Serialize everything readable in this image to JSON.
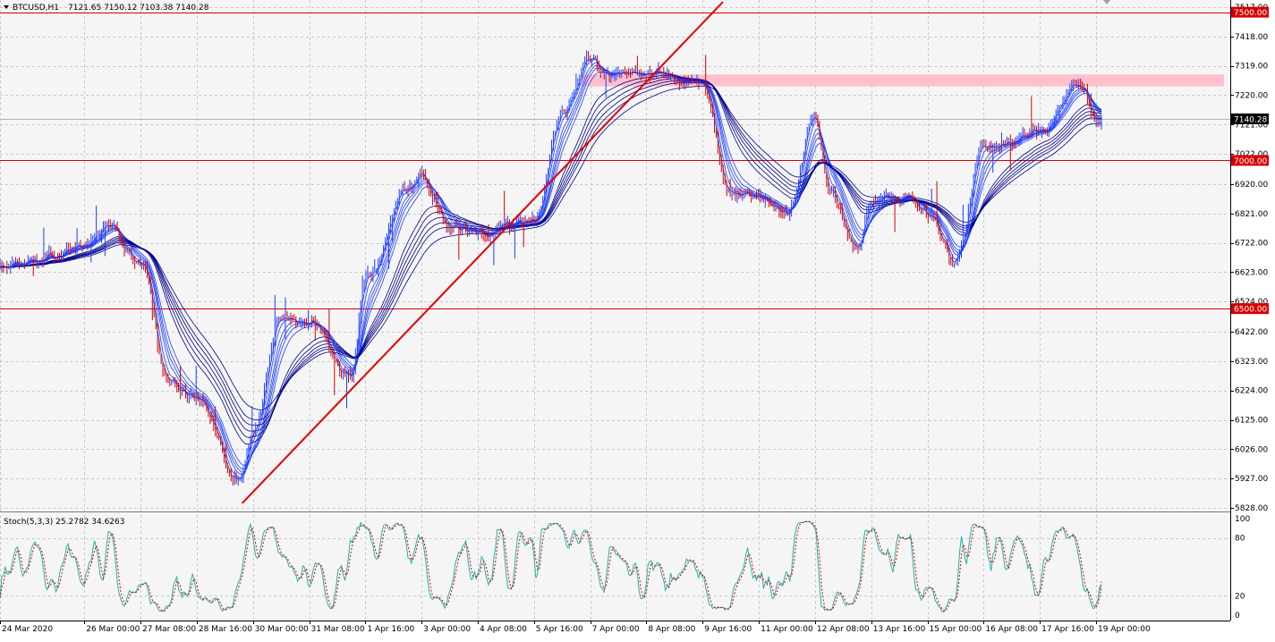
{
  "header": {
    "symbol_label": "BTCUSD,H1",
    "ohlc_label": "7121.65 7150.12 7103.38 7140.28"
  },
  "indicator": {
    "label": "Stoch(5,3,3) 25.2782 34.6263",
    "levels": [
      "100",
      "80",
      "20",
      "0"
    ]
  },
  "colors": {
    "background": "#f5f5f5",
    "grid": "#c8c8c8",
    "candle_up": "#1e3fff",
    "candle_down": "#d40000",
    "ma": "#00008b",
    "level_line": "#d40000",
    "trendline": "#e00000",
    "resistance_zone": "#ffc0cb",
    "stoch_main": "#20b2aa",
    "stoch_signal": "#d40000",
    "price_tag_bg": "#d40000",
    "price_tag_text": "#ffffff",
    "current_tag_bg": "#000000"
  },
  "price_axis": {
    "ticks": [
      "7517.00",
      "7418.00",
      "7319.00",
      "7220.00",
      "7121.00",
      "7022.00",
      "6920.00",
      "6821.00",
      "6722.00",
      "6623.00",
      "6524.00",
      "6422.00",
      "6323.00",
      "6224.00",
      "6125.00",
      "6026.00",
      "5927.00",
      "5828.00"
    ],
    "level_tags": [
      "7500.00",
      "7000.00",
      "6500.00"
    ],
    "current_price_tag": "7140.28"
  },
  "time_axis": {
    "labels": [
      "24 Mar 2020",
      "26 Mar 00:00",
      "27 Mar 08:00",
      "28 Mar 16:00",
      "30 Mar 00:00",
      "31 Mar 08:00",
      "1 Apr 16:00",
      "3 Apr 00:00",
      "4 Apr 08:00",
      "5 Apr 16:00",
      "7 Apr 00:00",
      "8 Apr 08:00",
      "9 Apr 16:00",
      "11 Apr 00:00",
      "12 Apr 08:00",
      "13 Apr 16:00",
      "15 Apr 00:00",
      "16 Apr 08:00",
      "17 Apr 16:00",
      "19 Apr 00:00"
    ]
  },
  "chart_data": {
    "type": "candlestick",
    "symbol": "BTCUSD",
    "timeframe": "H1",
    "last_ohlc": {
      "open": 7121.65,
      "high": 7150.12,
      "low": 7103.38,
      "close": 7140.28
    },
    "y_range": [
      5828,
      7517
    ],
    "horizontal_levels": [
      7500,
      7000,
      6500
    ],
    "resistance_zone": [
      7250,
      7290
    ],
    "trendline": [
      {
        "time": "30 Mar 00:00",
        "price": 5880
      },
      {
        "time": "10 Apr 00:00",
        "price": 7450
      }
    ],
    "price_path": [
      {
        "time": "24 Mar 2020",
        "price": 6650
      },
      {
        "time": "26 Mar 00:00",
        "price": 6700
      },
      {
        "time": "26 Mar 12:00",
        "price": 6780
      },
      {
        "time": "27 Mar 08:00",
        "price": 6660
      },
      {
        "time": "28 Mar 00:00",
        "price": 6250
      },
      {
        "time": "28 Mar 16:00",
        "price": 6190
      },
      {
        "time": "29 Mar 16:00",
        "price": 5930
      },
      {
        "time": "30 Mar 00:00",
        "price": 6080
      },
      {
        "time": "30 Mar 16:00",
        "price": 6480
      },
      {
        "time": "31 Mar 08:00",
        "price": 6460
      },
      {
        "time": "1 Apr 08:00",
        "price": 6260
      },
      {
        "time": "1 Apr 16:00",
        "price": 6600
      },
      {
        "time": "2 Apr 16:00",
        "price": 6900
      },
      {
        "time": "3 Apr 00:00",
        "price": 6950
      },
      {
        "time": "3 Apr 16:00",
        "price": 6780
      },
      {
        "time": "4 Apr 08:00",
        "price": 6760
      },
      {
        "time": "5 Apr 16:00",
        "price": 6800
      },
      {
        "time": "6 Apr 08:00",
        "price": 7150
      },
      {
        "time": "7 Apr 00:00",
        "price": 7340
      },
      {
        "time": "7 Apr 12:00",
        "price": 7280
      },
      {
        "time": "8 Apr 08:00",
        "price": 7300
      },
      {
        "time": "9 Apr 16:00",
        "price": 7270
      },
      {
        "time": "10 Apr 08:00",
        "price": 6880
      },
      {
        "time": "11 Apr 00:00",
        "price": 6880
      },
      {
        "time": "11 Apr 16:00",
        "price": 6820
      },
      {
        "time": "12 Apr 08:00",
        "price": 7150
      },
      {
        "time": "12 Apr 16:00",
        "price": 6900
      },
      {
        "time": "13 Apr 08:00",
        "price": 6700
      },
      {
        "time": "13 Apr 16:00",
        "price": 6860
      },
      {
        "time": "14 Apr 12:00",
        "price": 6880
      },
      {
        "time": "15 Apr 00:00",
        "price": 6820
      },
      {
        "time": "15 Apr 16:00",
        "price": 6650
      },
      {
        "time": "16 Apr 08:00",
        "price": 7050
      },
      {
        "time": "17 Apr 16:00",
        "price": 7100
      },
      {
        "time": "18 Apr 16:00",
        "price": 7260
      },
      {
        "time": "19 Apr 00:00",
        "price": 7140
      }
    ],
    "stochastic": {
      "k_period": 5,
      "d_period": 3,
      "slowing": 3,
      "main": 25.2782,
      "signal": 34.6263,
      "levels": [
        80,
        20
      ],
      "range": [
        0,
        100
      ]
    }
  }
}
